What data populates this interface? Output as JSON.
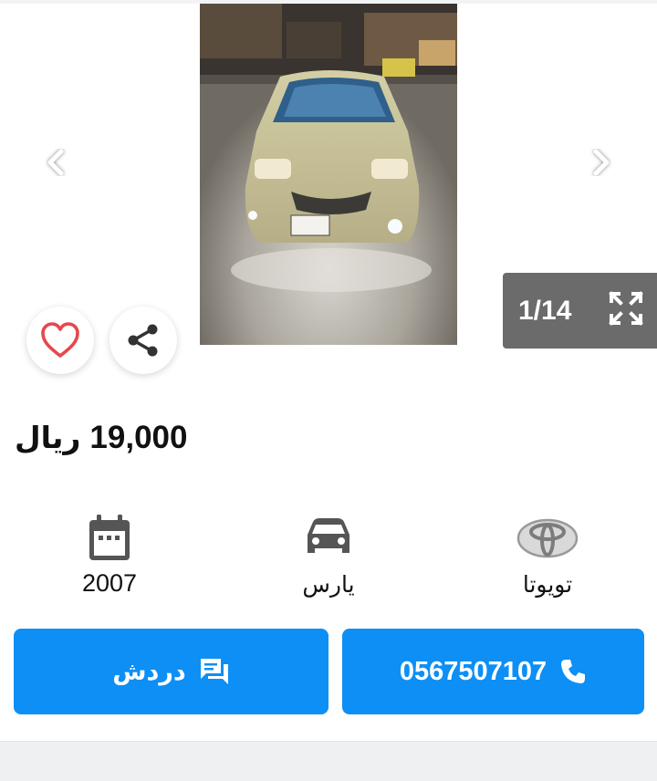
{
  "gallery": {
    "counter": "1/14",
    "icons": {
      "prev": "chevron-left-icon",
      "next": "chevron-right-icon",
      "expand": "fullscreen-icon",
      "favorite": "heart-icon",
      "share": "share-icon"
    }
  },
  "listing": {
    "price_value": "19,000",
    "price_currency": "ريال"
  },
  "specs": {
    "year": "2007",
    "model": "يارس",
    "make": "تويوتا",
    "icons": {
      "year": "calendar-icon",
      "model": "car-icon",
      "make": "toyota-logo-icon"
    }
  },
  "actions": {
    "chat_label": "دردش",
    "call_label": "0567507107",
    "icons": {
      "chat": "chat-bubble-icon",
      "call": "phone-icon"
    }
  },
  "colors": {
    "accent": "#0d8ff5",
    "favorite": "#e5484d",
    "counter_bg": "#6b6b6b"
  }
}
